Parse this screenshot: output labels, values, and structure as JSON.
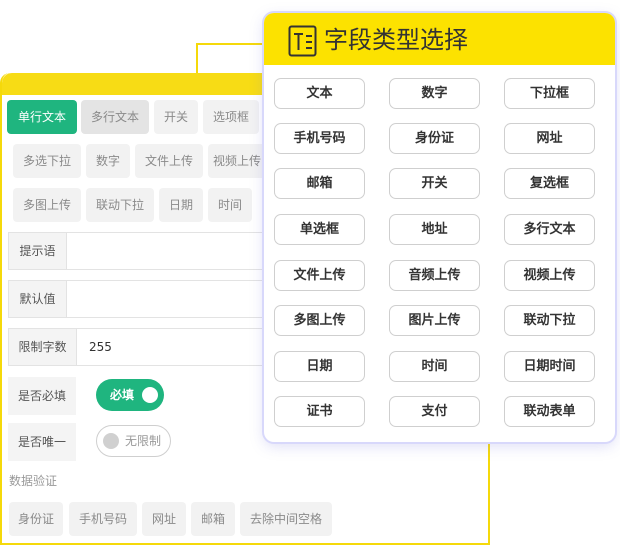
{
  "form": {
    "type_tabs": [
      "单行文本",
      "多行文本",
      "开关",
      "选项框"
    ],
    "type_row2": [
      "多选下拉",
      "数字",
      "文件上传",
      "视频上传"
    ],
    "type_row3": [
      "多图上传",
      "联动下拉",
      "日期",
      "时间"
    ],
    "hint_label": "提示语",
    "default_label": "默认值",
    "limit_label": "限制字数",
    "limit_value": "255",
    "required_label": "是否必填",
    "required_toggle": "必填",
    "unique_label": "是否唯一",
    "unique_toggle": "无限制",
    "validation_label": "数据验证",
    "validation_options": [
      "身份证",
      "手机号码",
      "网址",
      "邮箱",
      "去除中间空格"
    ]
  },
  "picker": {
    "title": "字段类型选择",
    "icon": "text-field-icon",
    "options": [
      [
        "文本",
        "数字",
        "下拉框"
      ],
      [
        "手机号码",
        "身份证",
        "网址"
      ],
      [
        "邮箱",
        "开关",
        "复选框"
      ],
      [
        "单选框",
        "地址",
        "多行文本"
      ],
      [
        "文件上传",
        "音频上传",
        "视频上传"
      ],
      [
        "多图上传",
        "图片上传",
        "联动下拉"
      ],
      [
        "日期",
        "时间",
        "日期时间"
      ],
      [
        "证书",
        "支付",
        "联动表单"
      ]
    ]
  },
  "colors": {
    "accent_green": "#1fb57f",
    "accent_yellow": "#fce200",
    "border_yellow": "#f5d90a"
  }
}
